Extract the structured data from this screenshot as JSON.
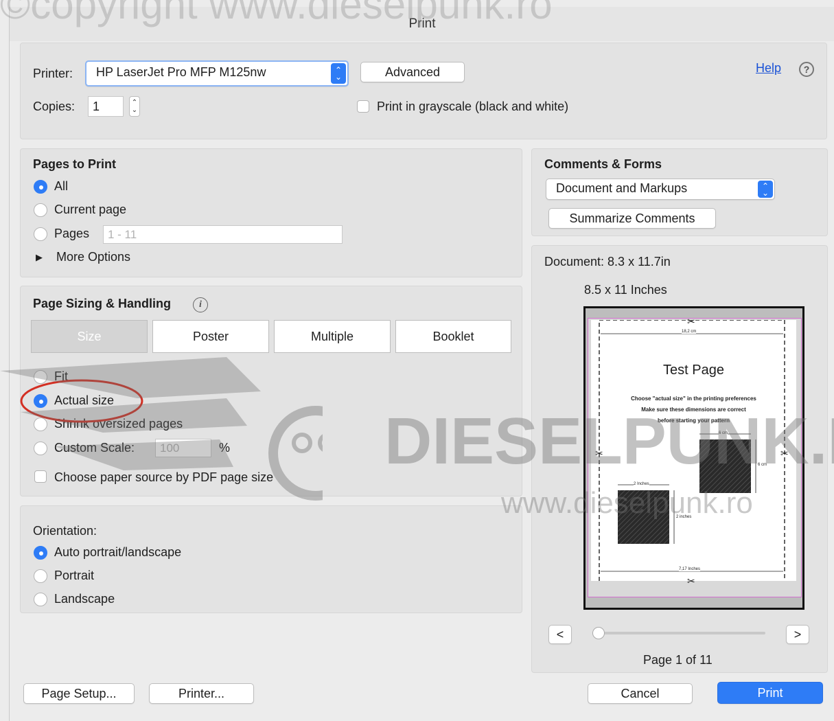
{
  "watermark": {
    "top": "©copyright www.dieselpunk.ro",
    "logo": "DIESELPUNK.R",
    "url": "www.dieselpunk.ro"
  },
  "window": {
    "title": "Print"
  },
  "printer": {
    "label": "Printer:",
    "value": "HP LaserJet Pro MFP M125nw",
    "advanced": "Advanced",
    "help": "Help",
    "help_icon": "?",
    "copies_label": "Copies:",
    "copies_value": "1",
    "grayscale": "Print in grayscale (black and white)",
    "grayscale_checked": false
  },
  "pages": {
    "heading": "Pages to Print",
    "all": "All",
    "current": "Current page",
    "pages": "Pages",
    "pages_placeholder": "1 - 11",
    "more": "More Options",
    "selected": "All"
  },
  "sizing": {
    "heading": "Page Sizing & Handling",
    "info_icon": "i",
    "tabs": [
      "Size",
      "Poster",
      "Multiple",
      "Booklet"
    ],
    "selected_tab": "Size",
    "fit": "Fit",
    "actual": "Actual size",
    "shrink": "Shrink oversized pages",
    "custom": "Custom Scale:",
    "custom_value": "100",
    "percent": "%",
    "paper_source": "Choose paper source by PDF page size",
    "selected": "Actual size",
    "highlight_color": "#d32f23"
  },
  "orientation": {
    "heading": "Orientation:",
    "auto": "Auto portrait/landscape",
    "portrait": "Portrait",
    "landscape": "Landscape",
    "selected": "Auto portrait/landscape"
  },
  "comments": {
    "heading": "Comments & Forms",
    "value": "Document and Markups",
    "summarize": "Summarize Comments"
  },
  "preview": {
    "document": "Document: 8.3 x 11.7in",
    "paper": "8.5 x 11 Inches",
    "page_title": "Test Page",
    "page_lines": [
      "Choose \"actual size\" in the printing preferences",
      "Make sure these dimensions are correct",
      "before starting your pattern"
    ],
    "dim_top": "18,2 cm",
    "dim_cm": "6 cm",
    "dim_cm_side": "6 cm",
    "dim_in": "2 Inches",
    "dim_in_side": "2 inches",
    "dim_bottom": "7,17 Inches",
    "prev": "<",
    "next": ">",
    "page_status": "Page 1 of 11",
    "slider_position": 0
  },
  "footer": {
    "page_setup": "Page Setup...",
    "printer": "Printer...",
    "cancel": "Cancel",
    "print": "Print"
  },
  "colors": {
    "accent": "#2e7cf6",
    "preview_border": "#d26fcf"
  }
}
